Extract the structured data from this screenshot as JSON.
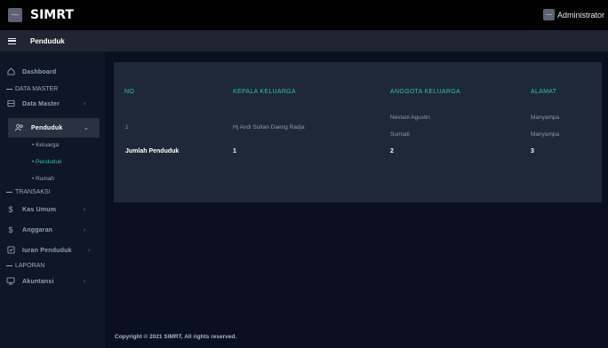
{
  "app": {
    "title": "SIMRT",
    "user": "Administrator"
  },
  "page": {
    "title": "Penduduk"
  },
  "sidebar": {
    "dashboard": "Dashboard",
    "section_master": "DATA MASTER",
    "data_master": "Data Master",
    "penduduk": "Penduduk",
    "sub_keluarga": "Keluarga",
    "sub_penduduk": "Penduduk",
    "sub_rumah": "Rumah",
    "section_transaksi": "TRANSAKSI",
    "kas_umum": "Kas Umum",
    "anggaran": "Anggaran",
    "iuran": "Iuran Penduduk",
    "section_laporan": "LAPORAN",
    "akuntansi": "Akuntansi"
  },
  "table": {
    "headers": {
      "no": "NO",
      "kepala": "KEPALA KELUARGA",
      "anggota": "ANGGOTA KELUARGA",
      "alamat": "ALAMAT"
    },
    "row1": {
      "no": "1",
      "kepala": "Hj Andi Sultan Daeng Radja",
      "anggota1": "Neviani Agustin",
      "anggota2": "Sumiati",
      "alamat1": "Manyampa",
      "alamat2": "Manyampa"
    },
    "total": {
      "label": "Jumlah Penduduk",
      "kepala": "1",
      "anggota": "2",
      "alamat": "3"
    }
  },
  "footer": {
    "text": "Copyright © 2021 SIMRT, All rights reserved."
  }
}
